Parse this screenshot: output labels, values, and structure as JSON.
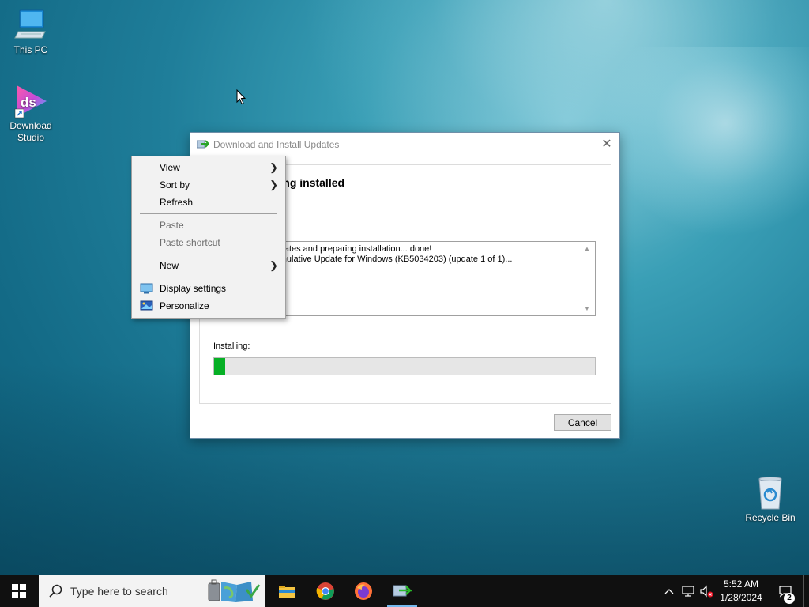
{
  "desktop": {
    "icons": [
      {
        "label": "This PC"
      },
      {
        "label": "Download Studio"
      },
      {
        "label": "Recycle Bin"
      }
    ]
  },
  "dialog": {
    "title": "Download and Install Updates",
    "close_glyph": "✕",
    "heading": "Updates are being installed",
    "log_lines": [
      "Searching for updates and preparing installation... done!",
      "Downloading Cumulative Update for Windows (KB5034203) (update 1 of 1)..."
    ],
    "visible_heading": "dates are being installed",
    "visible_log_lines": [
      "tion... done!",
      "for Windows (KB5034203) (update 1 of 1)..."
    ],
    "installing_label": "Installing:",
    "progress_fraction": 0.03,
    "cancel_label": "Cancel"
  },
  "context_menu": {
    "items": [
      {
        "label": "View",
        "submenu": true,
        "disabled": false
      },
      {
        "label": "Sort by",
        "submenu": true,
        "disabled": false
      },
      {
        "label": "Refresh",
        "submenu": false,
        "disabled": false
      },
      {
        "label": "Paste",
        "submenu": false,
        "disabled": true
      },
      {
        "label": "Paste shortcut",
        "submenu": false,
        "disabled": true
      },
      {
        "label": "New",
        "submenu": true,
        "disabled": false
      },
      {
        "label": "Display settings",
        "submenu": false,
        "disabled": false,
        "icon": "monitor-icon"
      },
      {
        "label": "Personalize",
        "submenu": false,
        "disabled": false,
        "icon": "personalize-icon"
      }
    ]
  },
  "taskbar": {
    "search_placeholder": "Type here to search",
    "apps": [
      "file-explorer-icon",
      "chrome-icon",
      "firefox-icon",
      "update-installer-icon"
    ],
    "clock_time": "5:52 AM",
    "clock_date": "1/28/2024",
    "notification_count": "2"
  },
  "colors": {
    "progress_green": "#06b025",
    "taskbar": "#101010",
    "menu_bg": "#f2f2f2"
  }
}
